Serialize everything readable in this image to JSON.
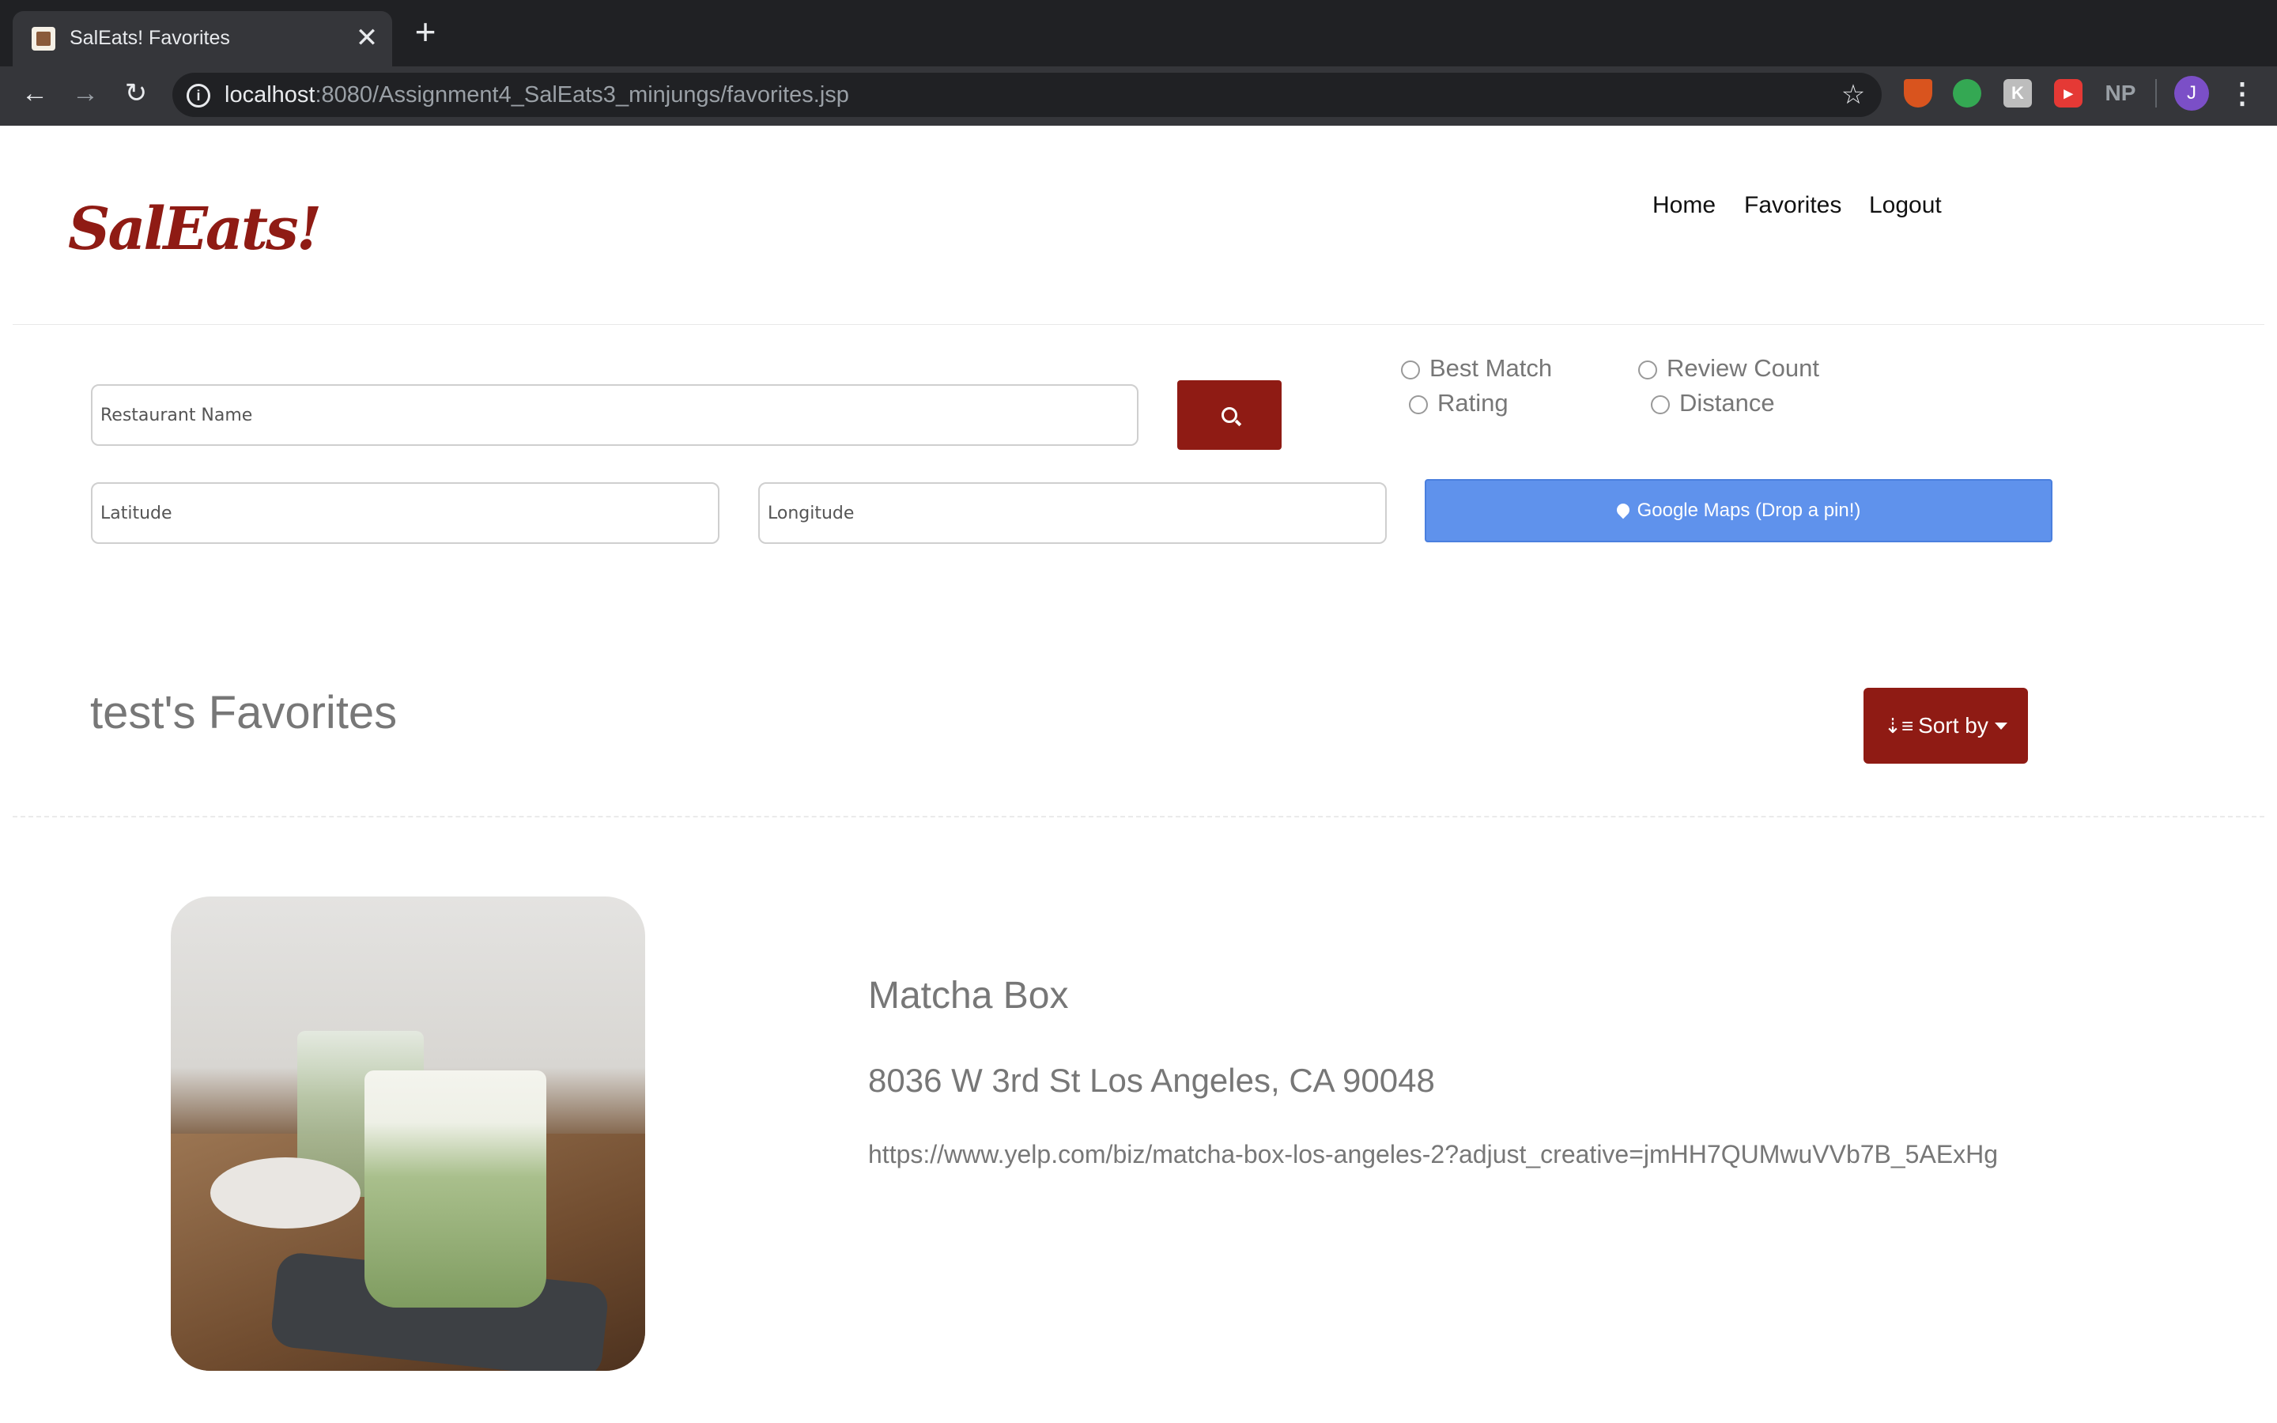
{
  "browser": {
    "tab_title": "SalEats! Favorites",
    "tab_close": "✕",
    "new_tab": "+",
    "url_host": "localhost",
    "url_path": ":8080/Assignment4_SalEats3_minjungs/favorites.jsp",
    "avatar_letter": "J",
    "ext_np": "NP"
  },
  "site": {
    "logo": "SalEats!",
    "nav": [
      "Home",
      "Favorites",
      "Logout"
    ]
  },
  "search": {
    "name_placeholder": "Restaurant Name",
    "lat_placeholder": "Latitude",
    "lng_placeholder": "Longitude",
    "sort_options": [
      "Best Match",
      "Review Count",
      "Rating",
      "Distance"
    ],
    "maps_button": "Google Maps (Drop a pin!)"
  },
  "favorites": {
    "title": "test's Favorites",
    "sort_label": "Sort by",
    "items": [
      {
        "name": "Matcha Box",
        "address": "8036 W 3rd St Los Angeles, CA 90048",
        "url": "https://www.yelp.com/biz/matcha-box-los-angeles-2?adjust_creative=jmHH7QUMwuVVb7B_5AExHg"
      }
    ]
  },
  "colors": {
    "brand": "#8f1b14",
    "maps_button": "#5f92ec",
    "chrome_dark": "#202124"
  }
}
